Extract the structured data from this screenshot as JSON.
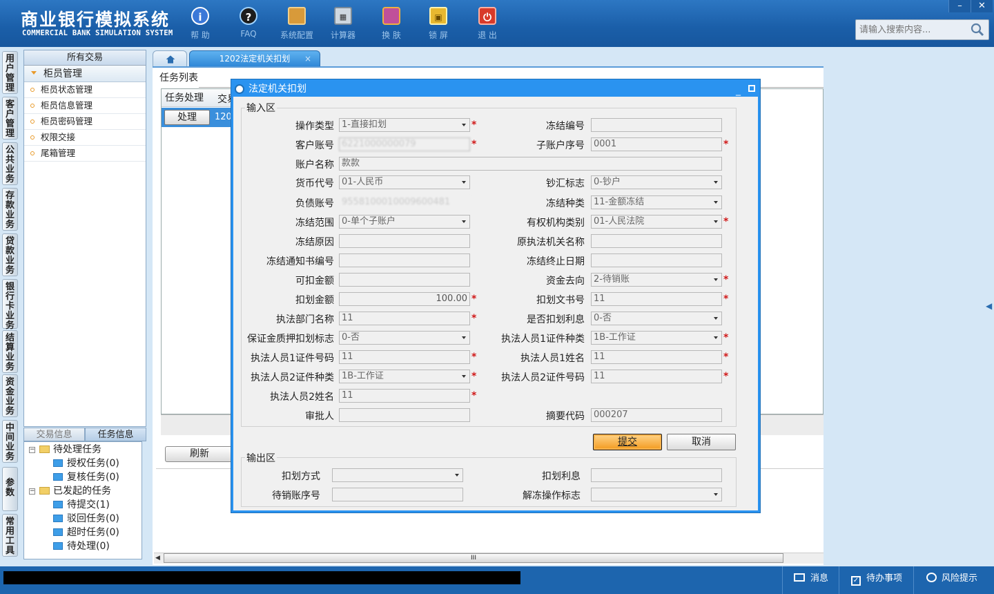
{
  "header": {
    "title": "商业银行模拟系统",
    "subtitle": "COMMERCIAL BANK SIMULATION SYSTEM",
    "toolbar": [
      {
        "label": "帮 助",
        "icon": "info-icon"
      },
      {
        "label": "FAQ",
        "icon": "question-icon"
      },
      {
        "label": "系统配置",
        "icon": "toolbox-icon"
      },
      {
        "label": "计算器",
        "icon": "calculator-icon"
      },
      {
        "label": "换 肤",
        "icon": "shirt-icon"
      },
      {
        "label": "锁 屏",
        "icon": "lock-icon"
      },
      {
        "label": "退 出",
        "icon": "power-icon"
      }
    ],
    "search_placeholder": "请输入搜索内容...",
    "window_min": "–",
    "window_close": "✕"
  },
  "left_nav": [
    "用户管理",
    "客户管理",
    "公共业务",
    "存款业务",
    "贷款业务",
    "银行卡业务",
    "结算业务",
    "资金业务",
    "中间业务",
    "参数",
    "常用工具"
  ],
  "tree": {
    "header": "所有交易",
    "group": "柜员管理",
    "items": [
      "柜员状态管理",
      "柜员信息管理",
      "柜员密码管理",
      "权限交接",
      "尾箱管理"
    ]
  },
  "bottom_tabs": [
    "交易信息",
    "任务信息"
  ],
  "task_tree": {
    "pending": "待处理任务",
    "auth": "授权任务(0)",
    "review": "复核任务(0)",
    "initiated": "已发起的任务",
    "to_submit": "待提交(1)",
    "rejected": "驳回任务(0)",
    "timeout": "超时任务(0)",
    "to_process": "待处理(0)"
  },
  "tabs": {
    "active": "1202法定机关扣划",
    "close": "×"
  },
  "main": {
    "task_list_title": "任务列表",
    "col_task": "任务处理",
    "col_trade": "交易",
    "process_button": "处理",
    "row_code": "1202",
    "refresh_button": "刷新",
    "scroll_grip": "III"
  },
  "dialog": {
    "title": "法定机关扣划",
    "input_legend": "输入区",
    "output_legend": "输出区",
    "submit": "提交",
    "cancel": "取消",
    "fields": {
      "op_type": {
        "label": "操作类型",
        "value": "1-直接扣划"
      },
      "freeze_no": {
        "label": "冻结编号",
        "value": ""
      },
      "cust_acct": {
        "label": "客户账号",
        "value": "6221000000079"
      },
      "sub_acct_no": {
        "label": "子账户序号",
        "value": "0001"
      },
      "acct_name": {
        "label": "账户名称",
        "value": "款款"
      },
      "currency": {
        "label": "货币代号",
        "value": "01-人民币"
      },
      "cash_flag": {
        "label": "钞汇标志",
        "value": "0-钞户"
      },
      "debt_acct": {
        "label": "负债账号",
        "value": "9558100010009600481"
      },
      "freeze_type": {
        "label": "冻结种类",
        "value": "11-金额冻结"
      },
      "freeze_scope": {
        "label": "冻结范围",
        "value": "0-单个子账户"
      },
      "org_type": {
        "label": "有权机构类别",
        "value": "01-人民法院"
      },
      "freeze_reason": {
        "label": "冻结原因",
        "value": ""
      },
      "orig_org_name": {
        "label": "原执法机关名称",
        "value": ""
      },
      "notice_no": {
        "label": "冻结通知书编号",
        "value": ""
      },
      "end_date": {
        "label": "冻结终止日期",
        "value": ""
      },
      "deductible": {
        "label": "可扣金额",
        "value": ""
      },
      "fund_dest": {
        "label": "资金去向",
        "value": "2-待销账"
      },
      "deduct_amt": {
        "label": "扣划金额",
        "value": "100.00"
      },
      "doc_no": {
        "label": "扣划文书号",
        "value": "11"
      },
      "dept_name": {
        "label": "执法部门名称",
        "value": "11"
      },
      "deduct_interest": {
        "label": "是否扣划利息",
        "value": "0-否"
      },
      "margin_flag": {
        "label": "保证金质押扣划标志",
        "value": "0-否"
      },
      "off1_id_type": {
        "label": "执法人员1证件种类",
        "value": "1B-工作证"
      },
      "off1_id_no": {
        "label": "执法人员1证件号码",
        "value": "11"
      },
      "off1_name": {
        "label": "执法人员1姓名",
        "value": "11"
      },
      "off2_id_type": {
        "label": "执法人员2证件种类",
        "value": "1B-工作证"
      },
      "off2_id_no": {
        "label": "执法人员2证件号码",
        "value": "11"
      },
      "off2_name": {
        "label": "执法人员2姓名",
        "value": "11"
      },
      "approver": {
        "label": "审批人",
        "value": ""
      },
      "summary_code": {
        "label": "摘要代码",
        "value": "000207"
      },
      "deduct_method": {
        "label": "扣划方式",
        "value": ""
      },
      "deduct_int_out": {
        "label": "扣划利息",
        "value": ""
      },
      "pending_seq": {
        "label": "待销账序号",
        "value": ""
      },
      "unfreeze_flag": {
        "label": "解冻操作标志",
        "value": ""
      }
    }
  },
  "statusbar": {
    "message": "消息",
    "todo": "待办事项",
    "risk": "风险提示"
  }
}
